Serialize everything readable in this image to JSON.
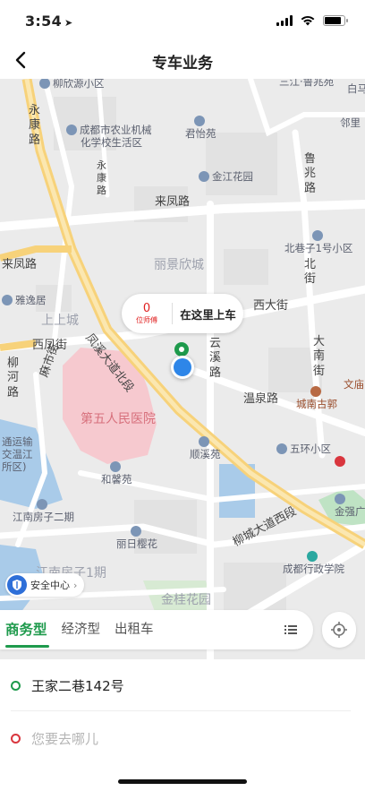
{
  "status_bar": {
    "time": "3:54",
    "battery_level": 0.85
  },
  "nav": {
    "title": "专车业务"
  },
  "map": {
    "labels": {
      "liuxinyuan": "柳欣源小区",
      "yongkanglu": "永康路",
      "agri_school_1": "成都市农业机械",
      "agri_school_2": "化学校生活区",
      "yongkang_small": "永康路",
      "junyiyuan": "君怡苑",
      "jinjiang": "金江花园",
      "sanjiang": "三江·鲁兆苑",
      "baima": "白马",
      "linli": "邻里",
      "lufu": "鲁兆路",
      "laifenglu": "来凤路",
      "beixiang": "北巷子1号小区",
      "beijie": "北街",
      "laifeng_left": "来凤路",
      "liujing": "丽景欣城",
      "yayiju": "雅逸居",
      "shangshangcheng": "上上城",
      "xidajie": "西大街",
      "xifengjie": "西凤街",
      "fengxi": "凤溪大道北段",
      "yunxi": "云溪路",
      "dananjie": "大南街",
      "liuhelu": "柳河路",
      "malinjie": "麻市街",
      "hospital": "第五人民医院",
      "wenmiao": "文庙",
      "wenquanlu": "温泉路",
      "chengnan": "城南古郭",
      "wuhuan": "五环小区",
      "shunxi": "顺溪苑",
      "yunshu_1": "通运输",
      "yunshu_2": "交温江",
      "yunshu_3": "所区)",
      "hexinyuan": "和馨苑",
      "jiangnan2": "江南房子二期",
      "liuchengxi": "柳城大道西段",
      "jinqiang": "金强广",
      "lirijing": "丽日樱花",
      "xingzheng": "成都行政学院",
      "jiangnan1": "江南房子1期",
      "jingui": "金桂花园"
    },
    "pickup_bubble": {
      "count": "0",
      "count_sub": "位师傅",
      "text": "在这里上车"
    },
    "safety_center": {
      "label": "安全中心"
    }
  },
  "tabs": [
    {
      "label": "商务型",
      "active": true
    },
    {
      "label": "经济型",
      "active": false
    },
    {
      "label": "出租车",
      "active": false
    }
  ],
  "trip": {
    "from": "王家二巷142号",
    "to_placeholder": "您要去哪儿"
  },
  "colors": {
    "accent": "#1e9a4c",
    "destination": "#d9363e",
    "location": "#2e86e8"
  },
  "icons": [
    "back-arrow-icon",
    "location-arrow-icon",
    "wifi-icon",
    "battery-icon",
    "pin-icon",
    "shield-icon",
    "list-icon",
    "locate-icon"
  ]
}
